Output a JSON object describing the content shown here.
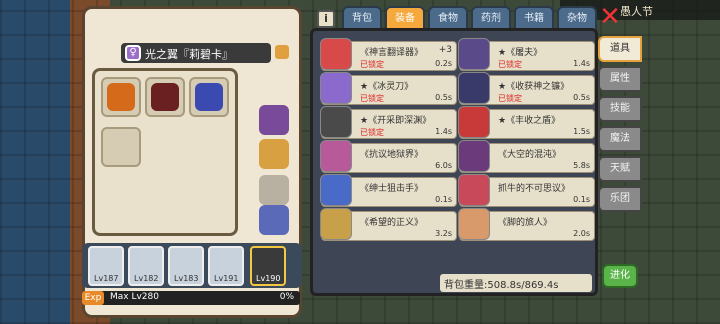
{
  "topbar": {
    "player_name": "愚人节"
  },
  "character": {
    "name": "光之翼『莉碧卡』",
    "gem_label": "♀"
  },
  "party": {
    "members": [
      {
        "label": "Lv187"
      },
      {
        "label": "Lv182"
      },
      {
        "label": "Lv183"
      },
      {
        "label": "Lv191"
      },
      {
        "label": "Lv190"
      }
    ]
  },
  "exp": {
    "tag": "Exp",
    "max_level": "Max Lv280",
    "percent": "0%"
  },
  "inventory": {
    "tabs": [
      "背包",
      "装备",
      "食物",
      "药剂",
      "书籍",
      "杂物"
    ],
    "active_tab": "装备",
    "items": [
      {
        "name": "《神言翻译器》",
        "plus": "+3",
        "lock": "已锁定",
        "weight": "0.2s"
      },
      {
        "name": "★《屠夫》",
        "plus": "",
        "lock": "已锁定",
        "weight": "1.4s"
      },
      {
        "name": "★《冰灵刀》",
        "plus": "",
        "lock": "已锁定",
        "weight": "0.5s"
      },
      {
        "name": "★《收获神之镰》",
        "plus": "",
        "lock": "已锁定",
        "weight": "0.5s"
      },
      {
        "name": "★《开采即深渊》",
        "plus": "",
        "lock": "已锁定",
        "weight": "1.4s"
      },
      {
        "name": "★《丰收之盾》",
        "plus": "",
        "lock": "",
        "weight": "1.5s"
      },
      {
        "name": "《抗议地狱界》",
        "plus": "",
        "lock": "",
        "weight": "6.0s"
      },
      {
        "name": "《大空的混沌》",
        "plus": "",
        "lock": "",
        "weight": "5.8s"
      },
      {
        "name": "《绅士狙击手》",
        "plus": "",
        "lock": "",
        "weight": "0.1s"
      },
      {
        "name": "抓牛的不可思议》",
        "plus": "",
        "lock": "",
        "weight": "0.1s"
      },
      {
        "name": "《希望的正义》",
        "plus": "",
        "lock": "",
        "weight": "3.2s"
      },
      {
        "name": "《脚的旅人》",
        "plus": "",
        "lock": "",
        "weight": "2.0s"
      }
    ],
    "weight_text": "背包重量:508.8s/869.4s"
  },
  "right_tabs": [
    "道具",
    "属性",
    "技能",
    "魔法",
    "天赋",
    "乐团"
  ],
  "right_active": "道具",
  "evolve_label": "进化",
  "colors": {
    "accent": "#f5a83c",
    "lock_red": "#d22222",
    "evolve_green": "#5ab44a"
  }
}
